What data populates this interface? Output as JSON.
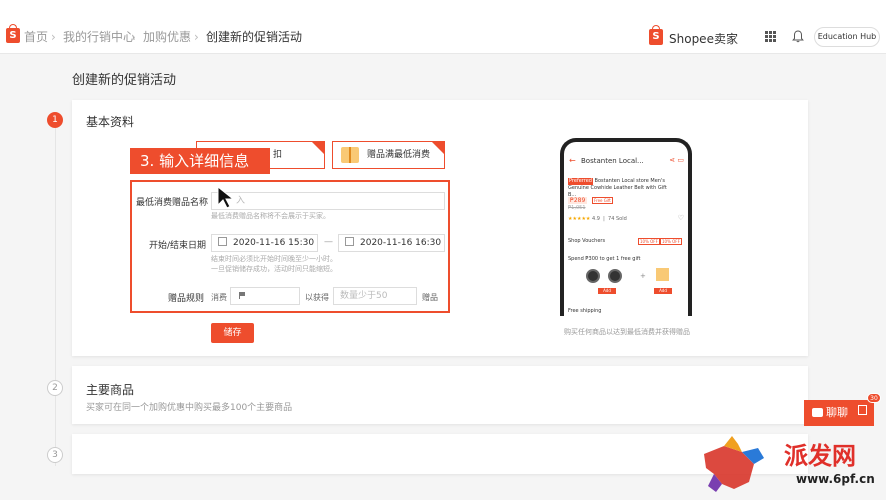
{
  "breadcrumb": {
    "home": "首页",
    "marketing": "我的行销中心",
    "addon": "加购优惠",
    "current": "创建新的促销活动"
  },
  "brand": {
    "logo_letter": "S",
    "name": "Shopee卖家"
  },
  "header": {
    "education_hub": "Education Hub"
  },
  "page_title": "创建新的促销活动",
  "steps": [
    "1",
    "2",
    "3"
  ],
  "section1": {
    "title": "基本资料",
    "tile1_label": "扣",
    "tile2_label": "赠品满最低消费",
    "annotation": "3. 输入详细信息",
    "name_label": "最低消费赠品名称",
    "name_placeholder": "入",
    "name_hint": "最低消费赠品名称将不会展示于买家。",
    "time_label": "开始/结束日期",
    "start_time": "2020-11-16 15:30",
    "end_time": "2020-11-16 16:30",
    "time_dash": "—",
    "time_hint1": "结束时间必须比开始时间晚至少一小时。",
    "time_hint2": "一旦促销储存成功，活动时间只能缩短。",
    "rule_label": "赠品规则",
    "rule_spend": "消费",
    "rule_get": "以获得",
    "rule_qty_placeholder": "数量少于50",
    "rule_unit": "赠品",
    "save": "储存",
    "phone_caption": "购买任何商品以达到最低消费并获得赠品"
  },
  "phone": {
    "title": "Bostanten Local...",
    "badge": "Preferred",
    "product_name": "Bostanten Local store Men's Genuine Cowhide Leather Belt with Gift B...",
    "price": "₱289",
    "old_price": "₱1,051",
    "tag": "Free Gift",
    "rating": "★★★★★",
    "rating_value": "4.9",
    "sold": "74 Sold",
    "vouchers": "Shop Vouchers",
    "voucher_tag1": "10% OFF",
    "voucher_tag2": "10% OFF",
    "gift_promo": "Spend ₱300 to get 1 free gift",
    "add_label": "Add",
    "shipping": "Free shipping"
  },
  "section2": {
    "title": "主要商品",
    "subtitle": "买家可在同一个加购优惠中购买最多100个主要商品"
  },
  "chat": {
    "label": "聊聊",
    "badge": "30"
  },
  "watermark": {
    "text": "派发网",
    "url": "www.6pf.cn"
  },
  "colors": {
    "accent": "#ee4d2d",
    "background": "#f5f5f5"
  }
}
